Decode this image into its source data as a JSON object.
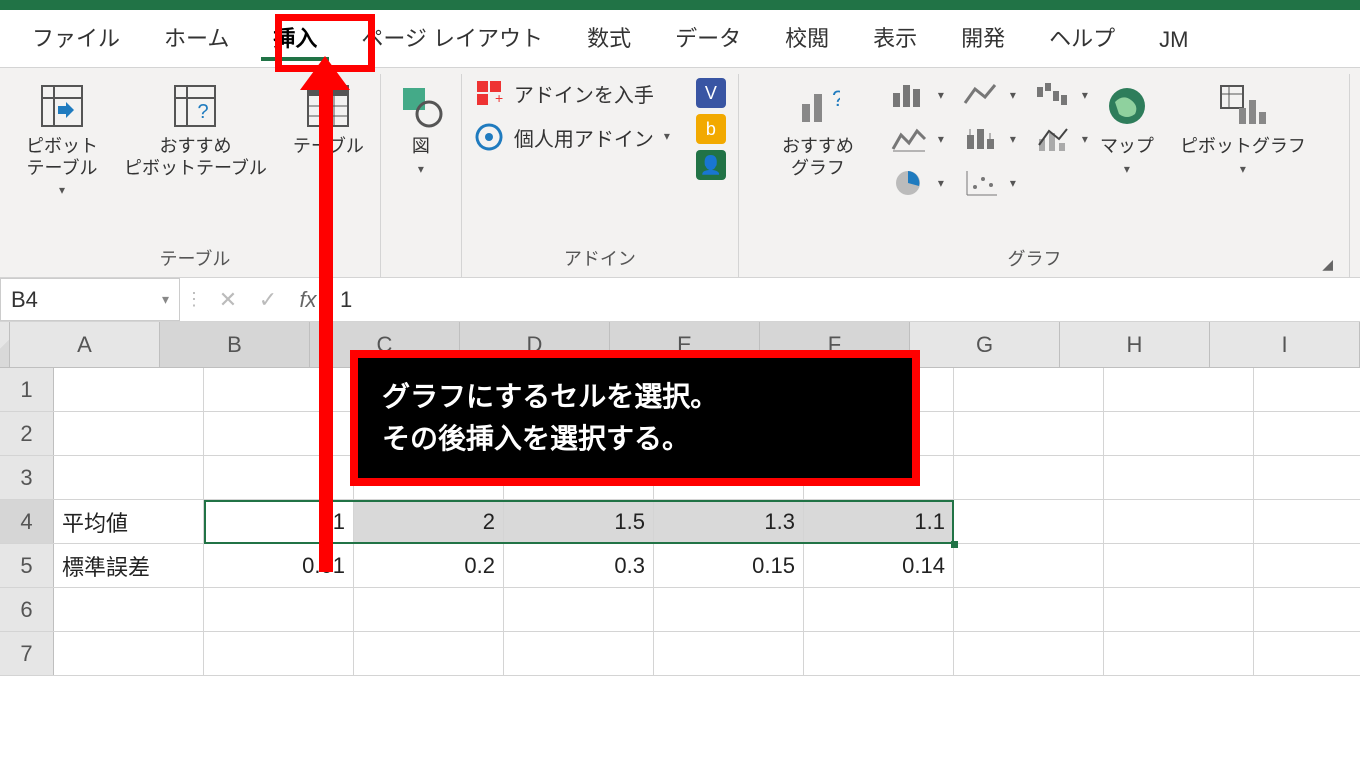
{
  "tabs": [
    "ファイル",
    "ホーム",
    "挿入",
    "ページ レイアウト",
    "数式",
    "データ",
    "校閲",
    "表示",
    "開発",
    "ヘルプ",
    "JM"
  ],
  "active_tab_index": 2,
  "ribbon": {
    "tables": {
      "pivot": "ピボット\nテーブル",
      "rec_pivot": "おすすめ\nピボットテーブル",
      "table": "テーブル",
      "group": "テーブル"
    },
    "illustrations": {
      "label": "図"
    },
    "addins": {
      "get": "アドインを入手",
      "my": "個人用アドイン",
      "group": "アドイン"
    },
    "charts": {
      "rec": "おすすめ\nグラフ",
      "map": "マップ",
      "pivotchart": "ピボットグラフ",
      "group": "グラフ"
    }
  },
  "formula_bar": {
    "name": "B4",
    "value": "1"
  },
  "columns": [
    "A",
    "B",
    "C",
    "D",
    "E",
    "F",
    "G",
    "H",
    "I"
  ],
  "rows": [
    "1",
    "2",
    "3",
    "4",
    "5",
    "6",
    "7"
  ],
  "data": {
    "4": {
      "A": "平均値",
      "B": "1",
      "C": "2",
      "D": "1.5",
      "E": "1.3",
      "F": "1.1"
    },
    "5": {
      "A": "標準誤差",
      "B": "0.01",
      "C": "0.2",
      "D": "0.3",
      "E": "0.15",
      "F": "0.14"
    }
  },
  "selection": {
    "active": "B4",
    "range": "B4:F4"
  },
  "annotation": {
    "line1": "グラフにするセルを選択。",
    "line2": "その後挿入を選択する。"
  },
  "chart_data": {
    "type": "table",
    "categories": [
      "B",
      "C",
      "D",
      "E",
      "F"
    ],
    "series": [
      {
        "name": "平均値",
        "values": [
          1,
          2,
          1.5,
          1.3,
          1.1
        ]
      },
      {
        "name": "標準誤差",
        "values": [
          0.01,
          0.2,
          0.3,
          0.15,
          0.14
        ]
      }
    ]
  }
}
